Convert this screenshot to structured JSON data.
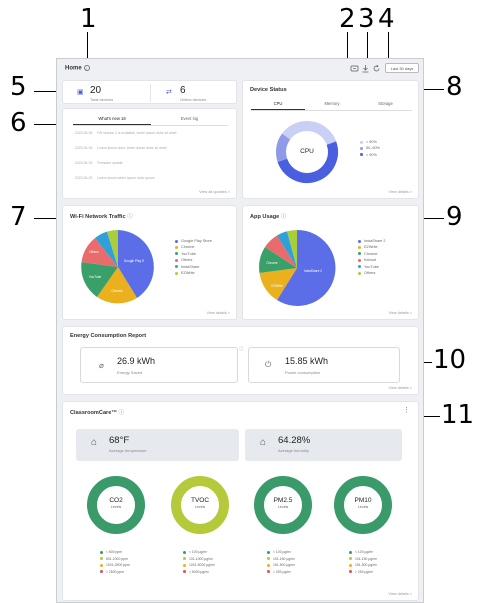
{
  "callouts": [
    "1",
    "2",
    "3",
    "4",
    "5",
    "6",
    "7",
    "8",
    "9",
    "10",
    "11"
  ],
  "topbar": {
    "title": "Home",
    "range_label": "Last 30 days",
    "icons": [
      "group-icon",
      "download-icon",
      "refresh-icon"
    ]
  },
  "devices": {
    "total_count": "20",
    "total_label": "Total devices",
    "online_count": "6",
    "online_label": "Online devices"
  },
  "events": {
    "tabs": [
      "What's new  18",
      "Event log"
    ],
    "rows": [
      {
        "date": "2023-06-05",
        "text": "FW version 2 is available, lorem ipsum dolor sit amet"
      },
      {
        "date": "2023-06-04",
        "text": "Lorem ipsum dolor, lorem ipsum dolor sit amet"
      },
      {
        "date": "2023-06-03",
        "text": "Firmware update"
      },
      {
        "date": "2023-06-02",
        "text": "Lorem ipsum lorem ipsum dolor ipsum"
      }
    ],
    "view_all": "View all updates >"
  },
  "device_status": {
    "title": "Device Status",
    "tabs": [
      "CPU",
      "Memory",
      "Storage"
    ],
    "center": "CPU",
    "legend": [
      "< 50%",
      "50–90%",
      "> 90%"
    ],
    "colors": [
      "#c9cff5",
      "#8f9ae8",
      "#4a5ee0"
    ],
    "view_details": "View details >"
  },
  "wifi": {
    "title": "Wi-Fi Network Traffic",
    "legend": [
      "Google Play Store",
      "Chrome",
      "YouTube",
      "Others",
      "InstaShare",
      "EZWrite"
    ],
    "colors": [
      "#5b6ee8",
      "#eab01e",
      "#3aa06a",
      "#ea6b6b",
      "#2fa0d8",
      "#a8cf3a"
    ],
    "slice_labels": [
      "Google Play S",
      "Chrome",
      "YouTube",
      "Others"
    ],
    "view_details": "View details >"
  },
  "app_usage": {
    "title": "App Usage",
    "legend": [
      "InstaShare 2",
      "EZWrite",
      "Chrome",
      "Kahoot",
      "YouTube",
      "Others"
    ],
    "colors": [
      "#5b6ee8",
      "#eab01e",
      "#3aa06a",
      "#ea6b6b",
      "#2fa0d8",
      "#a8cf3a"
    ],
    "slice_labels": [
      "InstaShare 2",
      "EZWrite",
      "Chrome"
    ],
    "view_details": "View details >"
  },
  "energy": {
    "title": "Energy Consumption Report",
    "saved_value": "26.9 kWh",
    "saved_label": "Energy Saved",
    "consumption_value": "15.85 kWh",
    "consumption_label": "Power consumption",
    "view_details": "View details >"
  },
  "classroom": {
    "title": "ClassroomCare™",
    "temp_value": "68°F",
    "temp_label": "Average temperature",
    "humidity_value": "64.28%",
    "humidity_label": "Average humidity",
    "rings": [
      {
        "label": "CO2",
        "sub": "Levels",
        "color": "#3a9a6a",
        "legend": [
          "< 600 ppm",
          "601-1000 ppm",
          "1001-2500 ppm",
          "> 2500 ppm"
        ]
      },
      {
        "label": "TVOC",
        "sub": "Levels",
        "color": "#b5c93a",
        "legend": [
          "< 100 μg/m³",
          "101-1000 μg/m³",
          "1001-5000 μg/m³",
          "> 5000 μg/m³"
        ]
      },
      {
        "label": "PM2.5",
        "sub": "Levels",
        "color": "#3a9a6a",
        "legend": [
          "< 100 μg/m³",
          "101-150 μg/m³",
          "151-500 μg/m³",
          "> 250 μg/m³"
        ]
      },
      {
        "label": "PM10",
        "sub": "Levels",
        "color": "#3a9a6a",
        "legend": [
          "< 100 μg/m³",
          "101-150 μg/m³",
          "151-500 μg/m³",
          "> 250 μg/m³"
        ]
      }
    ],
    "legend_colors": [
      "#3a9a6a",
      "#b5c93a",
      "#eab01e",
      "#e05050"
    ],
    "view_details": "View details >"
  }
}
